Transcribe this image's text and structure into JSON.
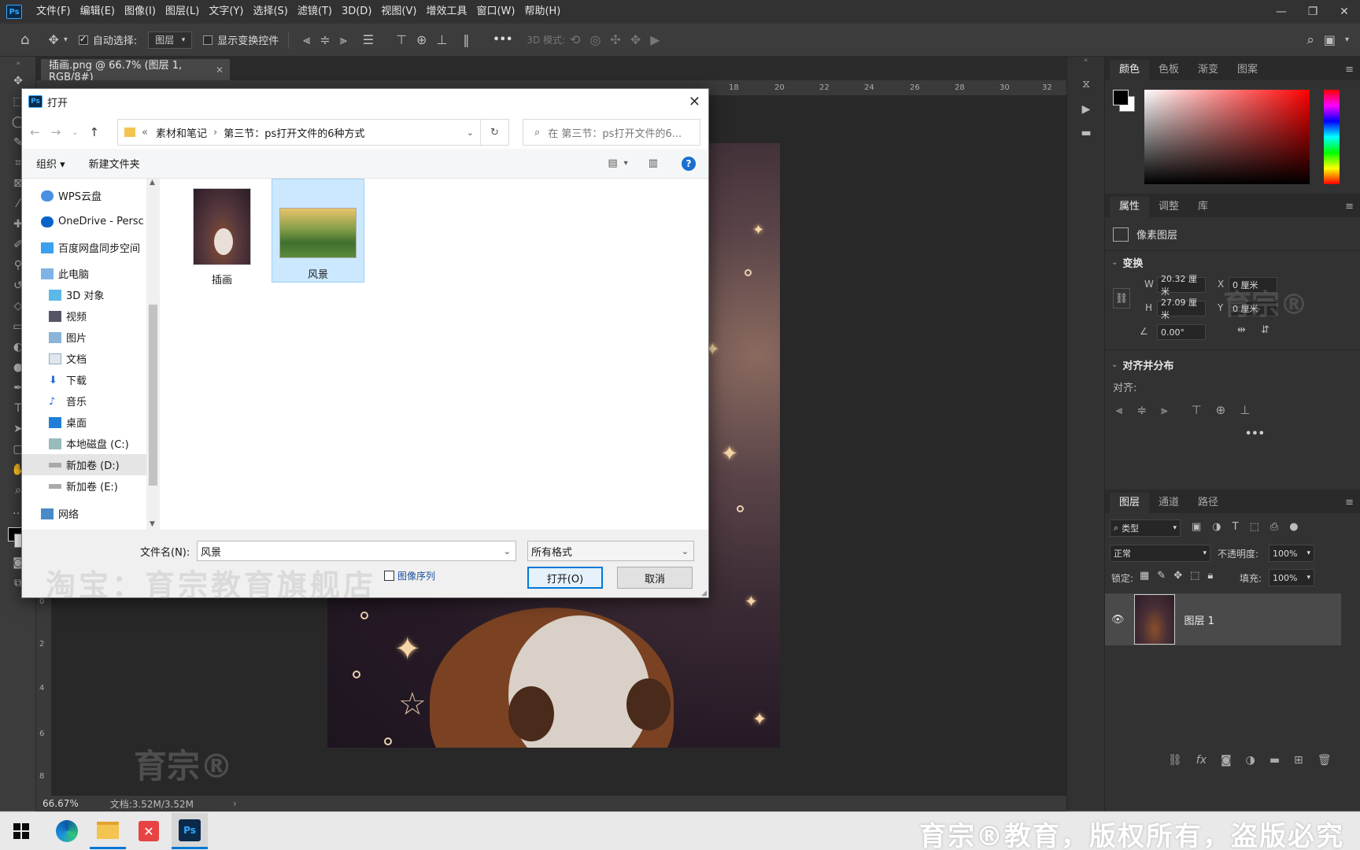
{
  "app": {
    "logo": "Ps",
    "menu": [
      "文件(F)",
      "编辑(E)",
      "图像(I)",
      "图层(L)",
      "文字(Y)",
      "选择(S)",
      "滤镜(T)",
      "3D(D)",
      "视图(V)",
      "增效工具",
      "窗口(W)",
      "帮助(H)"
    ]
  },
  "options_bar": {
    "auto_select_label": "自动选择:",
    "auto_select_value": "图层",
    "show_transform_label": "显示变换控件",
    "more": "•••",
    "mode_3d": "3D 模式:"
  },
  "document": {
    "tab_title": "插画.png @ 66.7% (图层 1, RGB/8#)",
    "ruler_ticks": [
      "18",
      "20",
      "22",
      "24",
      "26",
      "28",
      "30",
      "32"
    ],
    "left_ruler_ticks": [
      "0",
      "2",
      "4",
      "6",
      "8"
    ],
    "zoom": "66.67%",
    "doc_info": "文档:3.52M/3.52M"
  },
  "color_panel": {
    "tabs": [
      "颜色",
      "色板",
      "渐变",
      "图案"
    ]
  },
  "properties_panel": {
    "tabs": [
      "属性",
      "调整",
      "库"
    ],
    "layer_type": "像素图层",
    "transform_title": "变换",
    "w_label": "W",
    "w_value": "20.32 厘米",
    "x_label": "X",
    "x_value": "0 厘米",
    "h_label": "H",
    "h_value": "27.09 厘米",
    "y_label": "Y",
    "y_value": "0 厘米",
    "angle_value": "0.00°",
    "align_title": "对齐并分布",
    "align_label": "对齐:",
    "more": "•••",
    "watermark": "育宗®"
  },
  "layers_panel": {
    "tabs": [
      "图层",
      "通道",
      "路径"
    ],
    "filter_label": "类型",
    "blend_mode": "正常",
    "opacity_label": "不透明度:",
    "opacity_value": "100%",
    "lock_label": "锁定:",
    "fill_label": "填充:",
    "fill_value": "100%",
    "layer_name": "图层 1",
    "footer_fx": "fx"
  },
  "dialog": {
    "title": "打开",
    "path_sep": "«",
    "path_1": "素材和笔记",
    "path_2": "第三节：ps打开文件的6种方式",
    "search_placeholder": "在 第三节：ps打开文件的6...",
    "organize": "组织 ▾",
    "new_folder": "新建文件夹",
    "nav_items": [
      "WPS云盘",
      "OneDrive - Persc",
      "百度网盘同步空间",
      "此电脑",
      "3D 对象",
      "视频",
      "图片",
      "文档",
      "下载",
      "音乐",
      "桌面",
      "本地磁盘 (C:)",
      "新加卷 (D:)",
      "新加卷 (E:)",
      "网络"
    ],
    "files": [
      {
        "name": "插画",
        "selected": false
      },
      {
        "name": "风景",
        "selected": true
      }
    ],
    "filename_label": "文件名(N):",
    "filename_value": "风景",
    "filetype_value": "所有格式",
    "image_sequence_label": "图像序列",
    "open_button": "打开(O)",
    "cancel_button": "取消",
    "watermark": "淘宝：育宗教育旗舰店"
  },
  "canvas_watermark": "育宗®",
  "taskbar": {
    "watermark": "育宗®教育，版权所有，盗版必究"
  },
  "colors": {
    "ps_dark": "#323232",
    "ps_accent": "#31a8ff",
    "win_accent": "#0078d7",
    "selection": "#cce8ff"
  }
}
